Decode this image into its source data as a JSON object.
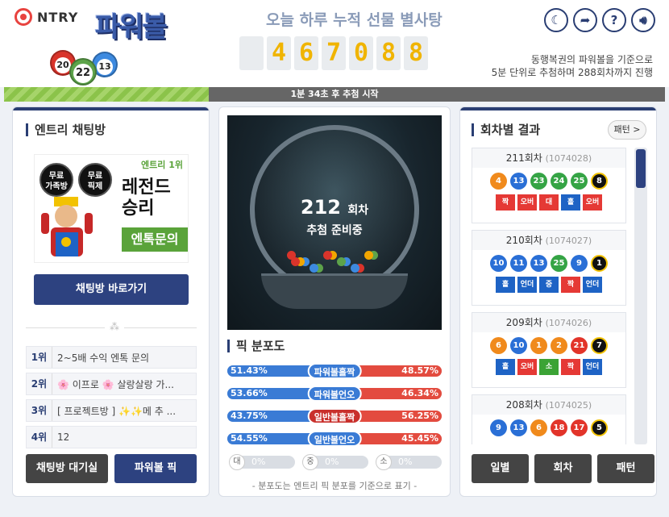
{
  "header": {
    "brand": "NTRY",
    "game_title": "파워볼",
    "logo_balls": [
      "20",
      "22",
      "13"
    ],
    "counter_title": "오늘 하루 누적 선물 별사탕",
    "counter_digits": [
      "4",
      "6",
      "7",
      "0",
      "8",
      "8"
    ],
    "info_line1": "동행복권의 파워볼을 기준으로",
    "info_line2": "5분 단위로 추첨하며 288회차까지 진행",
    "icons": [
      "moon-icon",
      "share-icon",
      "help-icon",
      "sound-icon"
    ]
  },
  "progress": {
    "label": "1분 34초 후 추첨 시작",
    "fraction": 0.31
  },
  "left": {
    "title": "엔트리 채팅방",
    "promo": {
      "badge1": "무료\n가족방",
      "badge2": "무료\n픽제",
      "rank": "엔트리 1위",
      "headline1": "레전드",
      "headline2": "승리",
      "cta": "엔톡문의"
    },
    "chat_button": "채팅방 바로가기",
    "ranks": [
      {
        "no": "1위",
        "text": "2~5배 수익 엔톡 문의"
      },
      {
        "no": "2위",
        "text": "🌸 이프로 🌸 살랑살랑 가..."
      },
      {
        "no": "3위",
        "text": "[ 프로젝트방 ] ✨✨메 추 ..."
      },
      {
        "no": "4위",
        "text": "12"
      }
    ],
    "btn_wait": "채팅방 대기실",
    "btn_pick": "파워볼 픽"
  },
  "middle": {
    "round": "212",
    "round_unit": "회차",
    "status": "추첨 준비중",
    "dist_title": "픽 분포도",
    "dist": [
      {
        "label": "파워볼홀짝",
        "left": "51.43%",
        "right": "48.57%",
        "lv": 51.43,
        "color": "#3a7bd5"
      },
      {
        "label": "파워볼언오",
        "left": "53.66%",
        "right": "46.34%",
        "lv": 53.66,
        "color": "#3a7bd5"
      },
      {
        "label": "일반볼홀짝",
        "left": "43.75%",
        "right": "56.25%",
        "lv": 43.75,
        "color": "#c9302c"
      },
      {
        "label": "일반볼언오",
        "left": "54.55%",
        "right": "45.45%",
        "lv": 54.55,
        "color": "#3a7bd5"
      }
    ],
    "tri": [
      {
        "k": "대",
        "v": "0%"
      },
      {
        "k": "중",
        "v": "0%"
      },
      {
        "k": "소",
        "v": "0%"
      }
    ],
    "footnote": "- 분포도는 엔트리 픽 분포를 기준으로 표기 -"
  },
  "right": {
    "title": "회차별 결과",
    "pattern_btn": "패턴 >",
    "results": [
      {
        "round": "211회차",
        "id": "(1074028)",
        "balls": [
          "4",
          "13",
          "23",
          "24",
          "25"
        ],
        "power": "8",
        "tags": [
          [
            "짝",
            "#e53935"
          ],
          [
            "오버",
            "#e53935"
          ],
          [
            "대",
            "#e53935"
          ],
          [
            "홀",
            "#1e63c5"
          ],
          [
            "오버",
            "#e53935"
          ]
        ]
      },
      {
        "round": "210회차",
        "id": "(1074027)",
        "balls": [
          "10",
          "11",
          "13",
          "25",
          "9"
        ],
        "power": "1",
        "tags": [
          [
            "홀",
            "#1e63c5"
          ],
          [
            "언더",
            "#1e63c5"
          ],
          [
            "중",
            "#1e63c5"
          ],
          [
            "짝",
            "#e53935"
          ],
          [
            "언더",
            "#1e63c5"
          ]
        ]
      },
      {
        "round": "209회차",
        "id": "(1074026)",
        "balls": [
          "6",
          "10",
          "1",
          "2",
          "21"
        ],
        "power": "7",
        "tags": [
          [
            "홀",
            "#1e63c5"
          ],
          [
            "오버",
            "#e53935"
          ],
          [
            "소",
            "#3ba335"
          ],
          [
            "짝",
            "#e53935"
          ],
          [
            "언더",
            "#1e63c5"
          ]
        ]
      },
      {
        "round": "208회차",
        "id": "(1074025)",
        "balls": [
          "9",
          "13",
          "6",
          "18",
          "17"
        ],
        "power": "5",
        "tags": []
      }
    ],
    "btn_daily": "일별",
    "btn_round": "회차",
    "btn_pattern": "패턴"
  }
}
